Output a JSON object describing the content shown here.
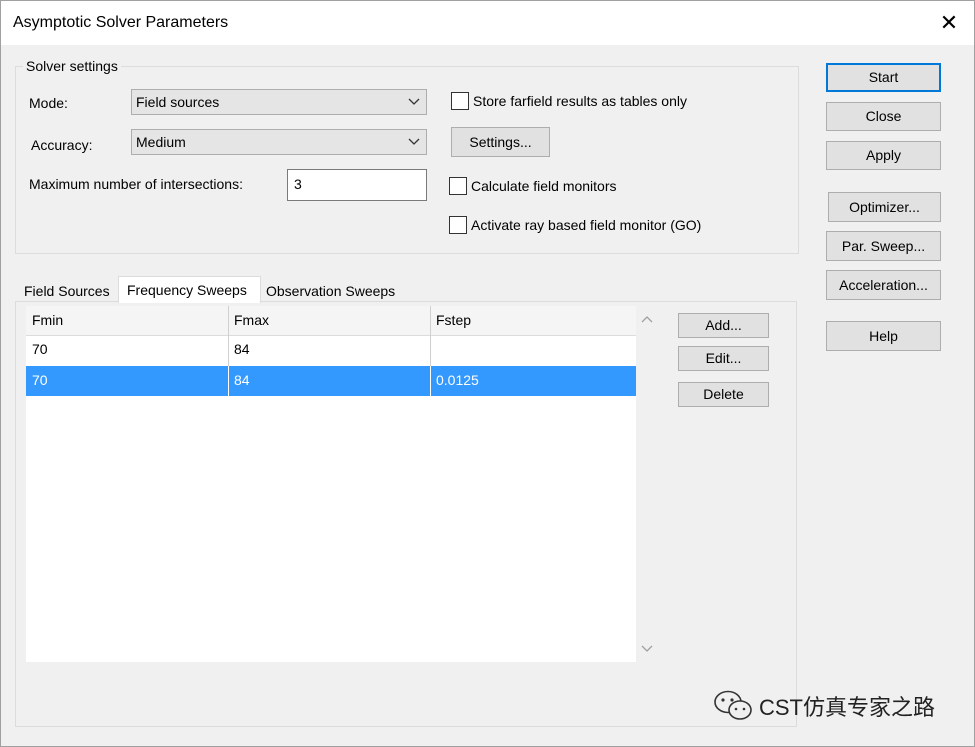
{
  "window": {
    "title": "Asymptotic Solver Parameters"
  },
  "solver_settings": {
    "legend": "Solver settings",
    "mode_label": "Mode:",
    "mode_value": "Field sources",
    "accuracy_label": "Accuracy:",
    "accuracy_value": "Medium",
    "max_intersections_label": "Maximum number of intersections:",
    "max_intersections_value": "3",
    "store_farfield_label": "Store farfield results as tables only",
    "settings_button": "Settings...",
    "calc_field_monitors_label": "Calculate field monitors",
    "ray_field_monitor_label": "Activate ray based field monitor (GO)"
  },
  "side_buttons": {
    "start": "Start",
    "close": "Close",
    "apply": "Apply",
    "optimizer": "Optimizer...",
    "par_sweep": "Par. Sweep...",
    "acceleration": "Acceleration...",
    "help": "Help"
  },
  "tabs": [
    {
      "label": "Field Sources",
      "active": false
    },
    {
      "label": "Frequency Sweeps",
      "active": true
    },
    {
      "label": "Observation Sweeps",
      "active": false
    }
  ],
  "table": {
    "columns": [
      "Fmin",
      "Fmax",
      "Fstep"
    ],
    "rows": [
      [
        "70",
        "84",
        ""
      ],
      [
        "70",
        "84",
        "0.0125"
      ]
    ],
    "selected_row": 1
  },
  "table_buttons": {
    "add": "Add...",
    "edit": "Edit...",
    "delete": "Delete"
  },
  "watermark": {
    "text": "CST仿真专家之路"
  },
  "colors": {
    "selection": "#3399ff",
    "focus_border": "#0078d7"
  }
}
